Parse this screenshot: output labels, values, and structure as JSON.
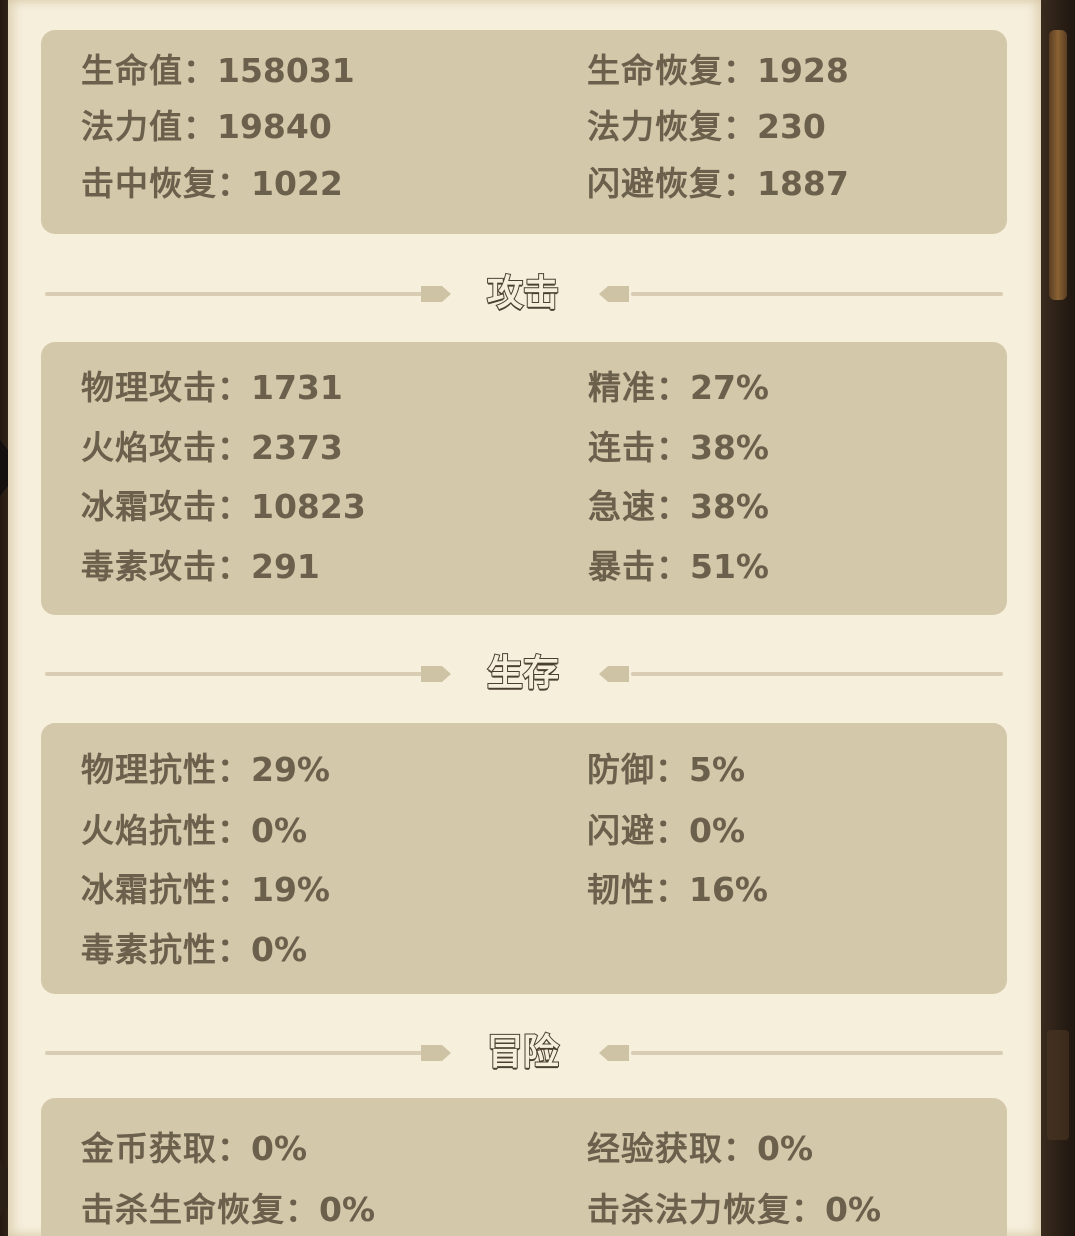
{
  "sections": {
    "attack_title": "攻击",
    "survival_title": "生存",
    "adventure_title": "冒险"
  },
  "basic": {
    "hp_label": "生命值：",
    "hp_value": "158031",
    "hp_regen_label": "生命恢复：",
    "hp_regen_value": "1928",
    "mp_label": "法力值：",
    "mp_value": "19840",
    "mp_regen_label": "法力恢复：",
    "mp_regen_value": "230",
    "hit_regen_label": "击中恢复：",
    "hit_regen_value": "1022",
    "dodge_regen_label": "闪避恢复：",
    "dodge_regen_value": "1887"
  },
  "attack": {
    "physical_label": "物理攻击：",
    "physical_value": "1731",
    "fire_label": "火焰攻击：",
    "fire_value": "2373",
    "frost_label": "冰霜攻击：",
    "frost_value": "10823",
    "poison_label": "毒素攻击：",
    "poison_value": "291",
    "accuracy_label": "精准：",
    "accuracy_value": "27%",
    "combo_label": "连击：",
    "combo_value": "38%",
    "haste_label": "急速：",
    "haste_value": "38%",
    "crit_label": "暴击：",
    "crit_value": "51%"
  },
  "survival": {
    "physical_res_label": "物理抗性：",
    "physical_res_value": "29%",
    "fire_res_label": "火焰抗性：",
    "fire_res_value": "0%",
    "frost_res_label": "冰霜抗性：",
    "frost_res_value": "19%",
    "poison_res_label": "毒素抗性：",
    "poison_res_value": "0%",
    "defense_label": "防御：",
    "defense_value": "5%",
    "dodge_label": "闪避：",
    "dodge_value": "0%",
    "toughness_label": "韧性：",
    "toughness_value": "16%"
  },
  "adventure": {
    "gold_label": "金币获取：",
    "gold_value": "0%",
    "exp_label": "经验获取：",
    "exp_value": "0%",
    "kill_hp_label": "击杀生命恢复：",
    "kill_hp_value": "0%",
    "kill_mp_label": "击杀法力恢复：",
    "kill_mp_value": "0%"
  },
  "colors": {
    "parchment": "#f6efdc",
    "panel": "#d4c8aa",
    "stat_text": "#6a604c",
    "title_stroke": "#4a3f30"
  }
}
